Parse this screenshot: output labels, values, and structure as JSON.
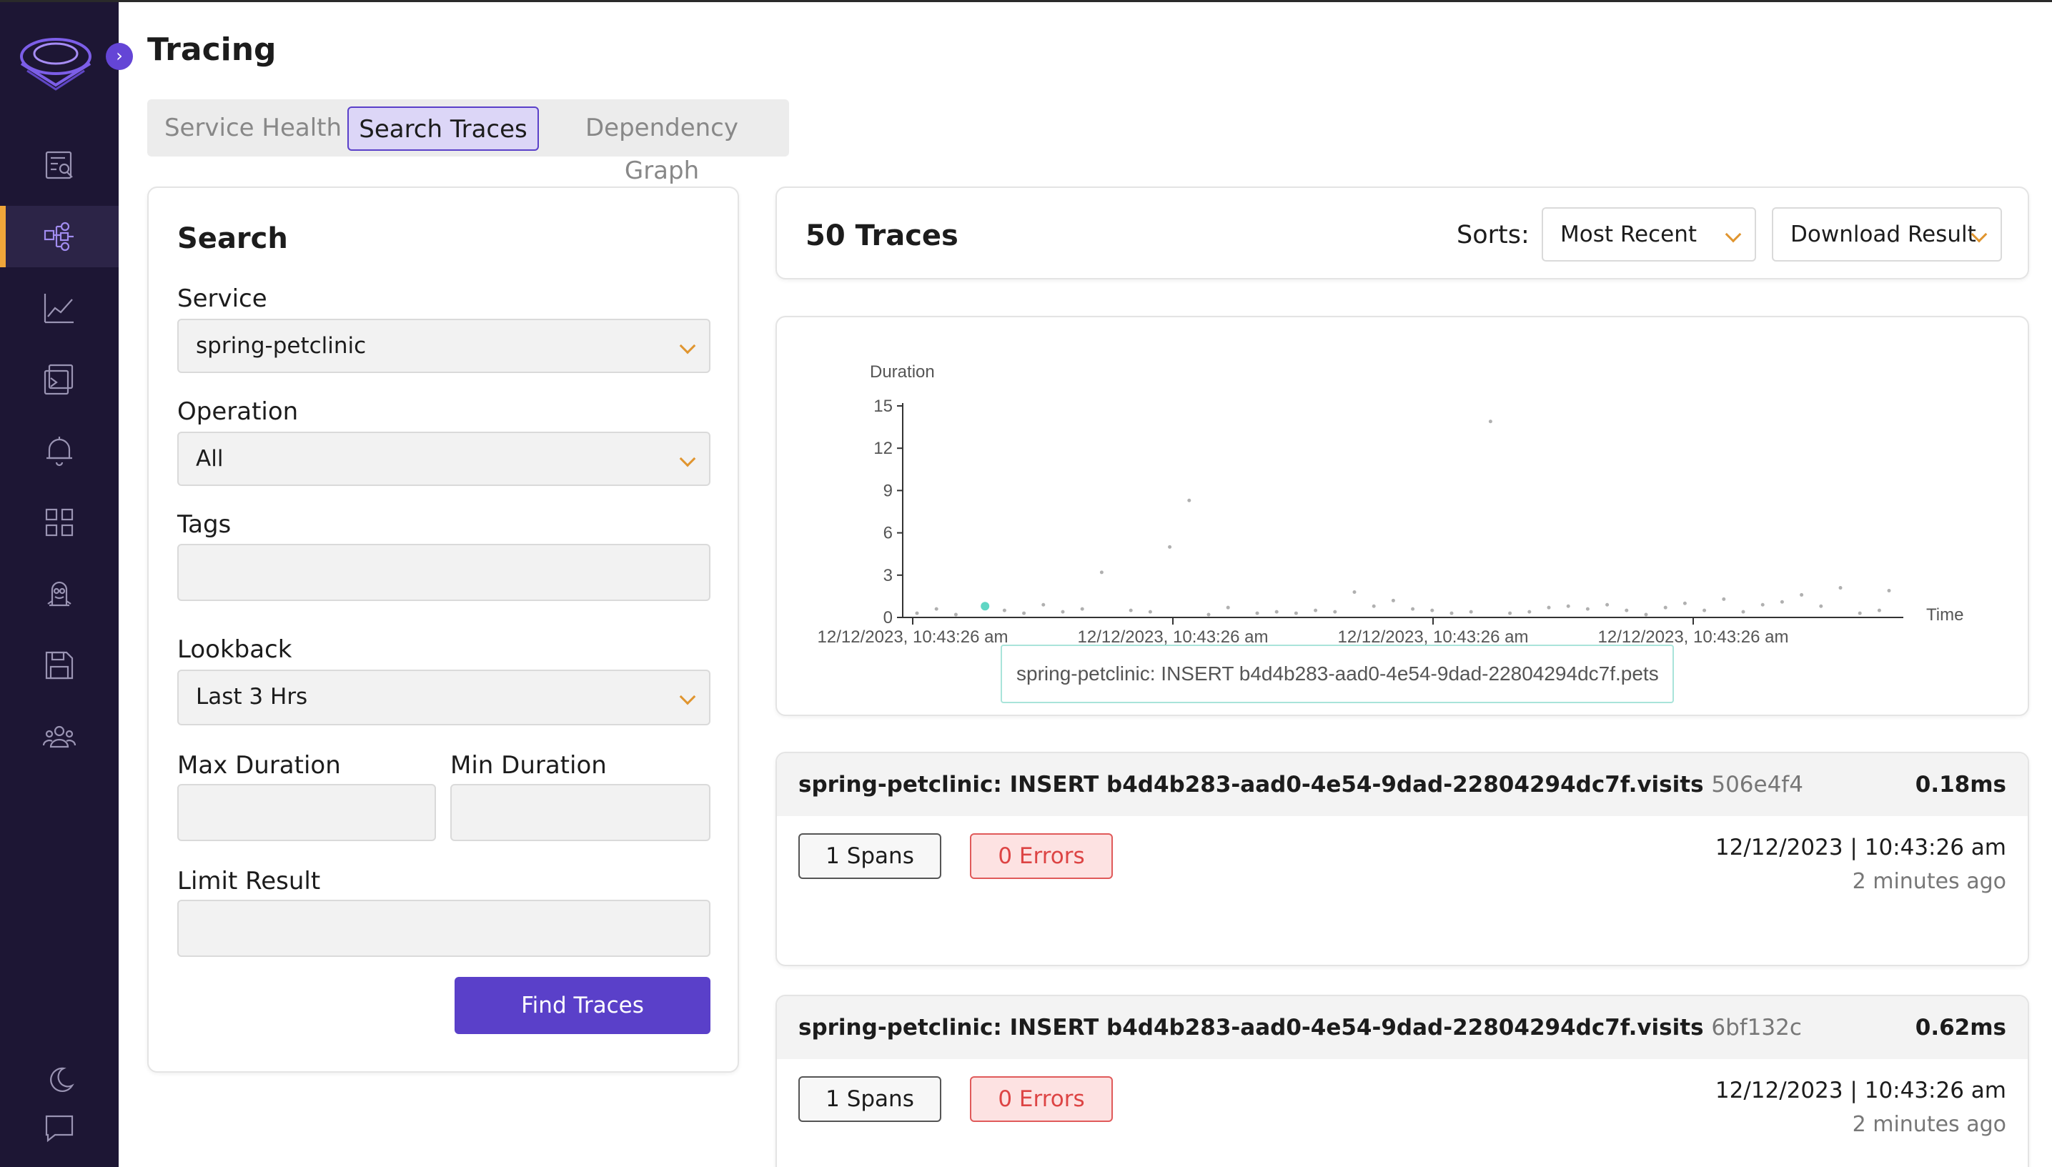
{
  "sidebar": {
    "items": [
      {
        "icon": "search-logs-icon"
      },
      {
        "icon": "traces-icon",
        "active": true
      },
      {
        "icon": "metrics-icon"
      },
      {
        "icon": "dashboards-icon"
      },
      {
        "icon": "alerts-icon"
      },
      {
        "icon": "apps-grid-icon"
      },
      {
        "icon": "monitor-icon"
      },
      {
        "icon": "save-icon"
      },
      {
        "icon": "teams-icon"
      }
    ],
    "bottom": [
      {
        "icon": "moon-icon"
      },
      {
        "icon": "chat-icon"
      }
    ],
    "collapse_glyph": "›"
  },
  "header": {
    "title": "Tracing"
  },
  "tabs": [
    {
      "label": "Service Health",
      "active": false
    },
    {
      "label": "Search Traces",
      "active": true
    },
    {
      "label": "Dependency Graph",
      "active": false
    }
  ],
  "search": {
    "title": "Search",
    "service_label": "Service",
    "service_value": "spring-petclinic",
    "operation_label": "Operation",
    "operation_value": "All",
    "tags_label": "Tags",
    "tags_value": "",
    "lookback_label": "Lookback",
    "lookback_value": "Last 3 Hrs",
    "max_duration_label": "Max Duration",
    "max_duration_value": "",
    "min_duration_label": "Min Duration",
    "min_duration_value": "",
    "limit_label": "Limit Result",
    "limit_value": "",
    "find_button": "Find Traces"
  },
  "results": {
    "count_label": "50 Traces",
    "sorts_label": "Sorts:",
    "sort_value": "Most Recent",
    "download_label": "Download Result"
  },
  "chart_data": {
    "type": "scatter",
    "ylabel": "Duration",
    "xlabel": "Time",
    "ylim": [
      0,
      15
    ],
    "yticks": [
      "0",
      "3",
      "6",
      "9",
      "12",
      "15"
    ],
    "xticks": [
      "12/12/2023, 10:43:26 am",
      "12/12/2023, 10:43:26 am",
      "12/12/2023, 10:43:26 am",
      "12/12/2023, 10:43:26 am"
    ],
    "x": [
      0,
      0.02,
      0.04,
      0.07,
      0.09,
      0.11,
      0.13,
      0.15,
      0.17,
      0.19,
      0.22,
      0.24,
      0.26,
      0.28,
      0.3,
      0.32,
      0.35,
      0.37,
      0.39,
      0.41,
      0.43,
      0.45,
      0.47,
      0.49,
      0.51,
      0.53,
      0.55,
      0.57,
      0.59,
      0.61,
      0.63,
      0.65,
      0.67,
      0.69,
      0.71,
      0.73,
      0.75,
      0.77,
      0.79,
      0.81,
      0.83,
      0.85,
      0.87,
      0.89,
      0.91,
      0.93,
      0.95,
      0.97,
      0.99,
      1.0
    ],
    "y": [
      0.3,
      0.6,
      0.2,
      0.8,
      0.5,
      0.3,
      0.9,
      0.4,
      0.6,
      3.2,
      0.5,
      0.4,
      5.0,
      8.3,
      0.2,
      0.7,
      0.3,
      0.4,
      0.3,
      0.5,
      0.4,
      1.8,
      0.8,
      1.2,
      0.6,
      0.5,
      0.3,
      0.4,
      13.9,
      0.3,
      0.4,
      0.7,
      0.8,
      0.6,
      0.9,
      0.5,
      0.2,
      0.7,
      1.0,
      0.5,
      1.3,
      0.4,
      0.9,
      1.1,
      1.6,
      0.8,
      2.1,
      0.3,
      0.5,
      1.9
    ],
    "highlight_index": 3,
    "tooltip": "spring-petclinic: INSERT b4d4b283-aad0-4e54-9dad-22804294dc7f.pets"
  },
  "traces": [
    {
      "name": "spring-petclinic: INSERT b4d4b283-aad0-4e54-9dad-22804294dc7f.visits",
      "id": "506e4f4",
      "duration": "0.18ms",
      "spans": "1 Spans",
      "errors": "0 Errors",
      "time": "12/12/2023 | 10:43:26 am",
      "ago": "2 minutes ago"
    },
    {
      "name": "spring-petclinic: INSERT b4d4b283-aad0-4e54-9dad-22804294dc7f.visits",
      "id": "6bf132c",
      "duration": "0.62ms",
      "spans": "1 Spans",
      "errors": "0 Errors",
      "time": "12/12/2023 | 10:43:26 am",
      "ago": "2 minutes ago"
    }
  ],
  "colors": {
    "sidebar_bg": "#1d1634",
    "accent": "#5a40c9",
    "active_marker": "#f0a63a",
    "error": "#d44444",
    "point": "#b0b0b0",
    "highlight_point": "#5fd6c4"
  }
}
